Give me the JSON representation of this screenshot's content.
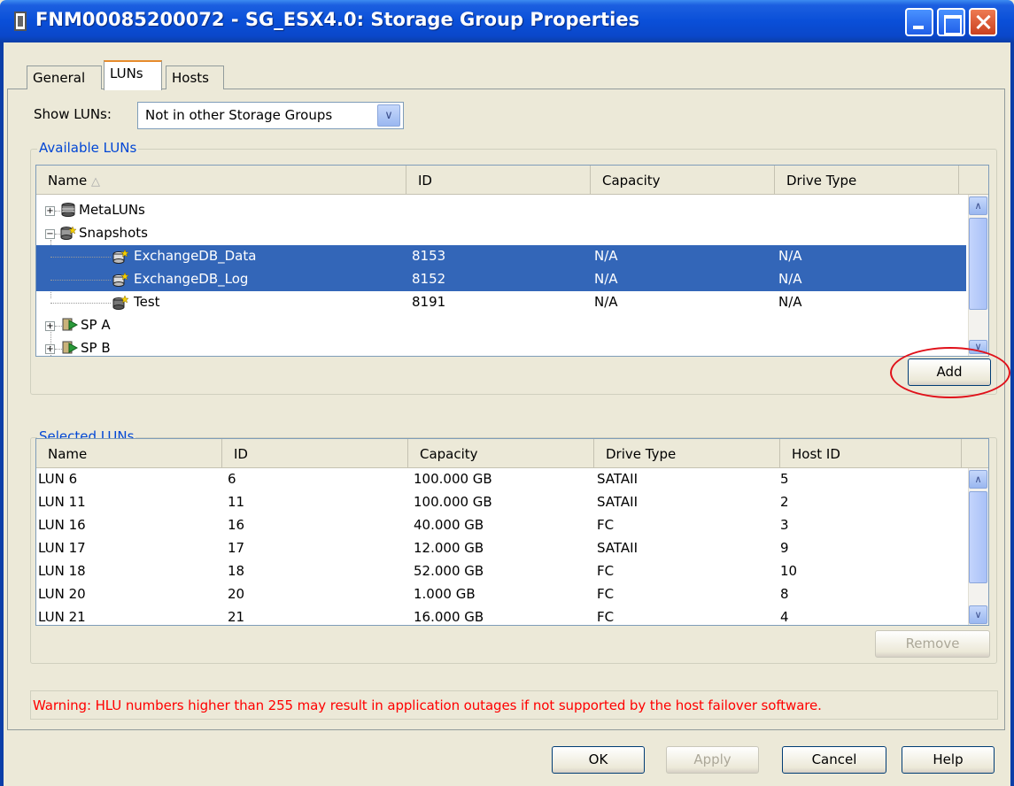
{
  "window": {
    "title": "FNM00085200072 - SG_ESX4.0: Storage Group Properties",
    "accent": "#0a4fd8"
  },
  "tabs": [
    {
      "label": "General"
    },
    {
      "label": "LUNs"
    },
    {
      "label": "Hosts"
    }
  ],
  "show_luns": {
    "label": "Show LUNs:",
    "value": "Not in other Storage Groups"
  },
  "available": {
    "group_label": "Available LUNs",
    "columns": [
      "Name",
      "ID",
      "Capacity",
      "Drive Type"
    ],
    "tree": [
      {
        "name": "MetaLUNs",
        "expander": "+"
      },
      {
        "name": "Snapshots",
        "expander": "-"
      },
      {
        "name": "ExchangeDB_Data",
        "id": "8153",
        "capacity": "N/A",
        "drive_type": "N/A",
        "selected": true
      },
      {
        "name": "ExchangeDB_Log",
        "id": "8152",
        "capacity": "N/A",
        "drive_type": "N/A",
        "selected": true
      },
      {
        "name": "Test",
        "id": "8191",
        "capacity": "N/A",
        "drive_type": "N/A",
        "selected": false
      },
      {
        "name": "SP A",
        "expander": "+"
      },
      {
        "name": "SP B",
        "expander": "+"
      }
    ],
    "add_label": "Add"
  },
  "selected": {
    "group_label": "Selected LUNs",
    "columns": [
      "Name",
      "ID",
      "Capacity",
      "Drive Type",
      "Host ID"
    ],
    "rows": [
      {
        "name": "LUN 6",
        "id": "6",
        "capacity": "100.000 GB",
        "drive_type": "SATAII",
        "host_id": "5"
      },
      {
        "name": "LUN 11",
        "id": "11",
        "capacity": "100.000 GB",
        "drive_type": "SATAII",
        "host_id": "2"
      },
      {
        "name": "LUN 16",
        "id": "16",
        "capacity": "40.000 GB",
        "drive_type": "FC",
        "host_id": "3"
      },
      {
        "name": "LUN 17",
        "id": "17",
        "capacity": "12.000 GB",
        "drive_type": "SATAII",
        "host_id": "9"
      },
      {
        "name": "LUN 18",
        "id": "18",
        "capacity": "52.000 GB",
        "drive_type": "FC",
        "host_id": "10"
      },
      {
        "name": "LUN 20",
        "id": "20",
        "capacity": "1.000 GB",
        "drive_type": "FC",
        "host_id": "8"
      },
      {
        "name": "LUN 21",
        "id": "21",
        "capacity": "16.000 GB",
        "drive_type": "FC",
        "host_id": "4"
      }
    ],
    "remove_label": "Remove"
  },
  "warning": "Warning: HLU numbers higher than 255 may result in application outages if not supported by the host failover software.",
  "buttons": {
    "ok": "OK",
    "apply": "Apply",
    "cancel": "Cancel",
    "help": "Help"
  },
  "colors": {
    "selection": "#3366b8",
    "warning": "#ff0000",
    "group_label": "#0046d5",
    "annotation_circle": "#e0111a"
  }
}
